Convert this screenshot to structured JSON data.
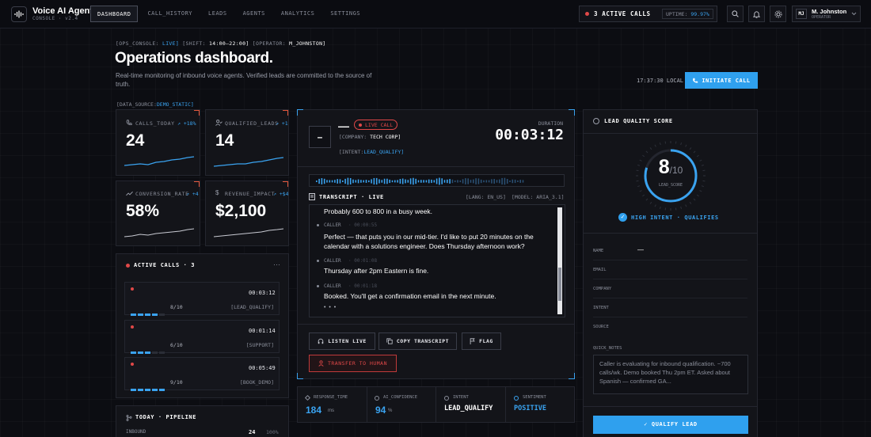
{
  "brand": {
    "title": "Voice AI Agent",
    "subtitle": "CONSOLE · v2.4"
  },
  "nav": [
    "DASHBOARD",
    "CALL_HISTORY",
    "LEADS",
    "AGENTS",
    "ANALYTICS",
    "SETTINGS"
  ],
  "status": {
    "active_calls": "3 ACTIVE CALLS",
    "uptime_label": "UPTIME:",
    "uptime_value": "99.97%"
  },
  "user": {
    "initials": "MJ",
    "name": "M. Johnston",
    "role": "OPERATOR"
  },
  "header": {
    "crumb_console_label": "[OPS_CONSOLE:",
    "crumb_console_value": "LIVE]",
    "crumb_shift_label": "[SHIFT:",
    "crumb_shift_value": "14:00–22:00]",
    "crumb_operator_label": "[OPERATOR:",
    "crumb_operator_value": "M_JOHNSTON]",
    "title": "Operations dashboard.",
    "subtitle": "Real-time monitoring of inbound voice agents. Verified leads are committed to the source of truth.",
    "clock": "17:37:30 LOCAL",
    "initiate_call": "INITIATE CALL",
    "data_source_label": "[DATA_SOURCE:",
    "data_source_value": "DEMO_STATIC]"
  },
  "kpis": [
    {
      "label": "CALLS_TODAY",
      "delta": "↗ +18%",
      "value": "24",
      "icon": "phone-icon"
    },
    {
      "label": "QUALIFIED_LEADS",
      "delta": "↗ +12",
      "value": "14",
      "icon": "user-check-icon"
    },
    {
      "label": "CONVERSION_RATE",
      "delta": "↗ +4.",
      "value": "58%",
      "icon": "trend-icon"
    },
    {
      "label": "REVENUE_IMPACT",
      "delta": "↗ +$42",
      "value": "$2,100",
      "icon": "dollar-icon"
    }
  ],
  "active_calls": {
    "title": "ACTIVE CALLS · 3",
    "more": "···",
    "items": [
      {
        "time": "00:03:12",
        "score": "8/10",
        "tag": "[LEAD_QUALIFY]",
        "score_fraction": 0.8
      },
      {
        "time": "00:01:14",
        "score": "6/10",
        "tag": "[SUPPORT]",
        "score_fraction": 0.6
      },
      {
        "time": "00:05:49",
        "score": "9/10",
        "tag": "[BOOK_DEMO]",
        "score_fraction": 0.9
      }
    ]
  },
  "pipeline": {
    "title": "TODAY · PIPELINE",
    "row_label": "INBOUND",
    "row_value": "24",
    "row_pct": "100%"
  },
  "call": {
    "avatar": "–",
    "caller_name": "—",
    "live_badge": "LIVE CALL",
    "company_label": "[COMPANY:",
    "company_value": "TECH CORP]",
    "intent_label": "[INTENT:",
    "intent_value": "LEAD_QUALIFY]",
    "duration_label": "DURATION",
    "duration": "00:03:12"
  },
  "transcript": {
    "title": "TRANSCRIPT · LIVE",
    "lang": "[LANG: EN_US]",
    "model": "[MODEL: ARIA_3.1]",
    "messages": [
      {
        "speaker": "",
        "time": "",
        "text": "Probably 600 to 800 in a busy week."
      },
      {
        "speaker": "CALLER",
        "time": "· 00:00:55",
        "text": "Perfect — that puts you in our mid-tier. I'd like to put 20 minutes on the calendar with a solutions engineer. Does Thursday afternoon work?"
      },
      {
        "speaker": "CALLER",
        "time": "· 00:01:08",
        "text": "Thursday after 2pm Eastern is fine."
      },
      {
        "speaker": "CALLER",
        "time": "· 00:01:18",
        "text": "Booked. You'll get a confirmation email in the next minute."
      }
    ],
    "typing": "• • •"
  },
  "actions": {
    "listen": "LISTEN LIVE",
    "copy": "COPY TRANSCRIPT",
    "flag": "FLAG",
    "transfer": "TRANSFER TO HUMAN"
  },
  "metrics": [
    {
      "label": "RESPONSE_TIME",
      "value": "184",
      "unit": "ms"
    },
    {
      "label": "AI_CONFIDENCE",
      "value": "94",
      "unit": "%"
    },
    {
      "label": "INTENT",
      "value": "LEAD_QUALIFY",
      "unit": ""
    },
    {
      "label": "SENTIMENT",
      "value": "POSITIVE",
      "unit": ""
    }
  ],
  "lead": {
    "title": "LEAD QUALITY SCORE",
    "score": "8",
    "score_denominator": "/10",
    "score_fraction": 0.8,
    "score_caption": "LEAD_SCORE",
    "intent_badge": "HIGH INTENT · QUALIFIES",
    "fields": [
      {
        "label": "NAME",
        "value": "—"
      },
      {
        "label": "EMAIL",
        "value": ""
      },
      {
        "label": "COMPANY",
        "value": ""
      },
      {
        "label": "INTENT",
        "value": ""
      },
      {
        "label": "SOURCE",
        "value": ""
      }
    ],
    "notes_label": "QUICK_NOTES",
    "notes": "Caller is evaluating for inbound qualification. ~700 calls/wk. Demo booked Thu 2pm ET. Asked about Spanish — confirmed GA...",
    "qualify_button": "✓ QUALIFY LEAD"
  },
  "colors": {
    "accent": "#3aa3f0",
    "alert": "#e04848",
    "panel": "#131419"
  }
}
